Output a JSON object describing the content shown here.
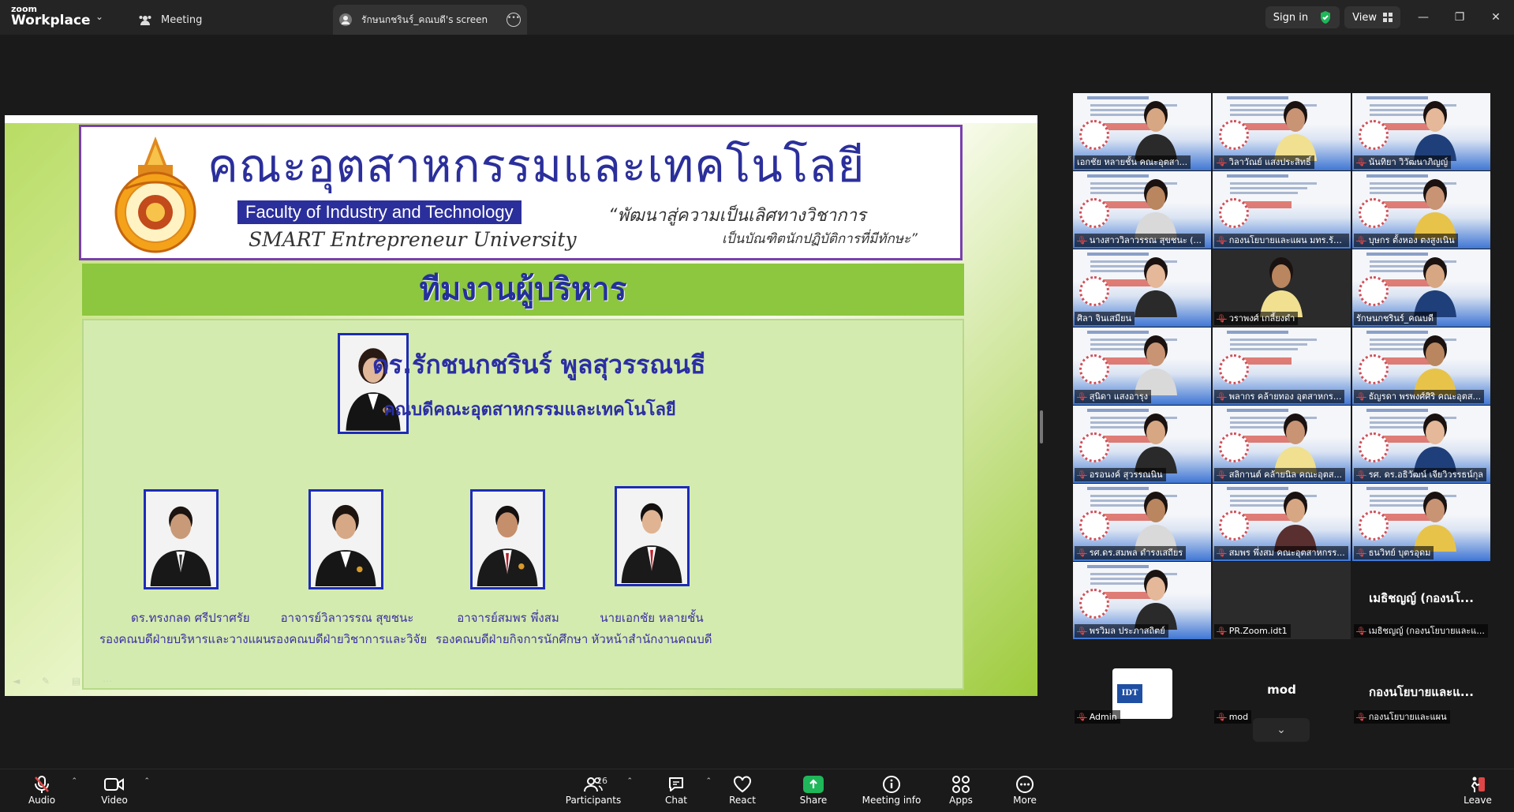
{
  "app": {
    "logo_line1": "zoom",
    "logo_line2": "Workplace",
    "tabs": [
      {
        "label": "Meeting",
        "icon": "meeting-icon"
      },
      {
        "label": "รักษนกชรินร์_คณบดี's screen",
        "icon": "screen-share-icon"
      }
    ],
    "sign_in": "Sign in",
    "view": "View",
    "accent": "#1fb75a"
  },
  "slide": {
    "faculty_thai": "คณะอุตสาหกรรมและเทคโนโลยี",
    "faculty_eng": "Faculty of Industry and Technology",
    "slogan": "SMART Entrepreneur University",
    "motto_line1": "“พัฒนาสู่ความเป็นเลิศทางวิชาการ",
    "motto_line2": "เป็นบัณฑิตนักปฏิบัติการที่มีทักษะ”",
    "team_title": "ทีมงานผู้บริหาร",
    "dean_name": "ดร.รักชนกชรินร์  พูลสุวรรณนธี",
    "dean_title": "คณบดีคณะอุตสาหกรรมและเทคโนโลยี",
    "staff": [
      {
        "name": "ดร.ทรงกลด  ศรีปราศรัย",
        "role": "รองคณบดีฝ่ายบริหารและวางแผน"
      },
      {
        "name": "อาจารย์วิลาวรรณ  สุขชนะ",
        "role": "รองคณบดีฝ่ายวิชาการและวิจัย"
      },
      {
        "name": "อาจารย์สมพร  พึ่งสม",
        "role": "รองคณบดีฝ่ายกิจการนักศึกษา"
      },
      {
        "name": "นายเอกชัย  หลายชั้น",
        "role": "หัวหน้าสำนักงานคณบดี"
      }
    ]
  },
  "gallery": {
    "tiles": [
      {
        "label": "เอกชัย  หลายชั้น คณะอุตสา...",
        "muted": false,
        "person": true,
        "dark": false
      },
      {
        "label": "วิลาวัณย์ แสงประสิทธิ์",
        "muted": true,
        "person": true,
        "dark": false
      },
      {
        "label": "นันทิยา วิวัฒนาภิญญ์",
        "muted": true,
        "person": true,
        "dark": false
      },
      {
        "label": "นางสาววิลาวรรณ สุขชนะ (...",
        "muted": true,
        "person": true,
        "dark": false
      },
      {
        "label": "กองนโยบายและแผน มทร.รัต...",
        "muted": true,
        "person": false,
        "dark": false
      },
      {
        "label": "บุษกร ตั้งหอง ตงสูงเนิน",
        "muted": true,
        "person": true,
        "dark": false
      },
      {
        "label": "ศิลา จินเสมียน",
        "muted": false,
        "person": true,
        "dark": false
      },
      {
        "label": "วราพงศ์ เกลี้ยงดำ",
        "muted": true,
        "person": true,
        "dark": true
      },
      {
        "label": "รักษนกชรินร์_คณบดี",
        "muted": false,
        "person": true,
        "dark": false,
        "selected": true
      },
      {
        "label": "สุนิดา แสงอารุง",
        "muted": true,
        "person": true,
        "dark": false
      },
      {
        "label": "พลากร คล้ายทอง อุตสาหกร...",
        "muted": true,
        "person": false,
        "dark": false
      },
      {
        "label": "ธัญรดา พรพงศ์ศิริ คณะอุตส...",
        "muted": true,
        "person": true,
        "dark": false
      },
      {
        "label": "อรอนงค์ สุวรรณนิน",
        "muted": true,
        "person": true,
        "dark": false
      },
      {
        "label": "สลิกานต์ คล้ายนิล คณะอุตส...",
        "muted": true,
        "person": true,
        "dark": false
      },
      {
        "label": "รศ. ดร.อธิวัฒน์ เจียวิวรรธน์กุล",
        "muted": true,
        "person": true,
        "dark": false
      },
      {
        "label": "รศ.ดร.สมพล ดำรงเสถียร",
        "muted": true,
        "person": true,
        "dark": false
      },
      {
        "label": "สมพร พึ่งสม คณะอุตสาหกรร...",
        "muted": true,
        "person": true,
        "dark": false
      },
      {
        "label": "ธนวิทย์ บุตรอุดม",
        "muted": true,
        "person": true,
        "dark": false
      },
      {
        "label": "พรวิมล ประภาสถิตย์",
        "muted": true,
        "person": true,
        "dark": false
      },
      {
        "label": "PR.Zoom.idt1",
        "muted": true,
        "person": false,
        "dark": true
      },
      {
        "label": "เมธิชญญ์ (กองนโยบายและแ...",
        "muted": true,
        "bigname": "เมธิชญญ์ (กองนโ...",
        "textonly": true
      },
      {
        "label": "Admin",
        "muted": true,
        "avatar": true,
        "textonly": true
      },
      {
        "label": "mod",
        "muted": true,
        "bigname": "mod",
        "textonly": true
      },
      {
        "label": "กองนโยบายและแผน",
        "muted": true,
        "bigname": "กองนโยบายและแ...",
        "textonly": true
      }
    ],
    "avatar_text": "IDT"
  },
  "toolbar": {
    "audio": "Audio",
    "video": "Video",
    "participants": "Participants",
    "participants_count": "26",
    "chat": "Chat",
    "react": "React",
    "share": "Share",
    "meeting_info": "Meeting info",
    "apps": "Apps",
    "more": "More",
    "leave": "Leave"
  }
}
